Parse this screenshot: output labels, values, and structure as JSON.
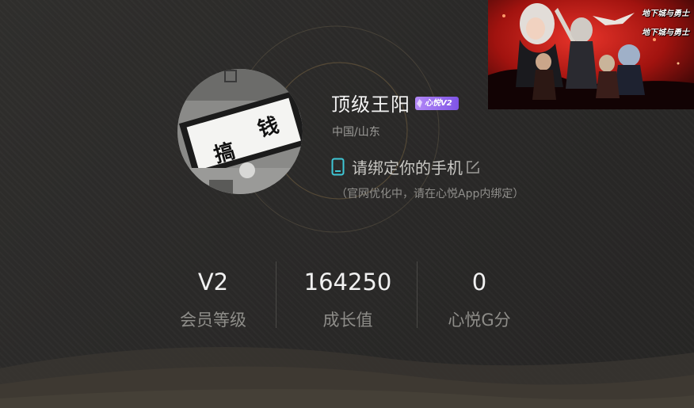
{
  "profile": {
    "username": "顶级王阳",
    "vip_badge": "心悦V2",
    "location": "中国/山东",
    "bind_phone_text": "请绑定你的手机",
    "bind_phone_note": "（官网优化中，请在心悦App内绑定）"
  },
  "avatar": {
    "calligraphy_chars": [
      "搞",
      "钱"
    ]
  },
  "stats": [
    {
      "value": "V2",
      "label": "会员等级"
    },
    {
      "value": "164250",
      "label": "成长值"
    },
    {
      "value": "0",
      "label": "心悦G分"
    }
  ],
  "banner": {
    "title_top": "地下城与勇士",
    "title_bottom": "地下城与勇士"
  },
  "colors": {
    "background": "#2c2b29",
    "accent_cyan": "#3fc7d6",
    "vip_purple": "#9a6cf0",
    "ring_gold": "#6b5a3e"
  }
}
